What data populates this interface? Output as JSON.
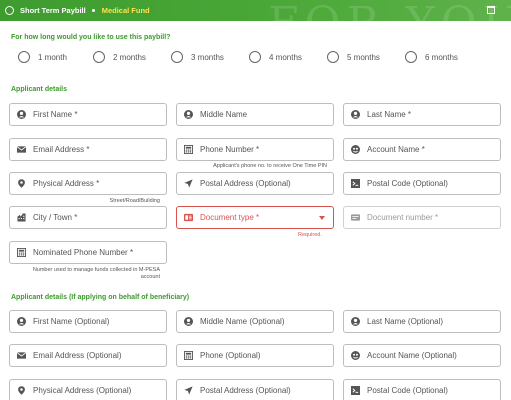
{
  "header": {
    "title": "Short Term Paybill",
    "subtitle": "Medical Fund",
    "background_text": "FOR YOU",
    "accent": "#3e9b2f",
    "subtitle_color": "#ffe24d"
  },
  "duration": {
    "question": "For how long would you like to use this paybill?",
    "options": [
      "1 month",
      "2 months",
      "3 months",
      "4 months",
      "5 months",
      "6 months"
    ]
  },
  "applicant": {
    "section_title": "Applicant details",
    "first_name": "First Name *",
    "middle_name": "Middle Name",
    "last_name": "Last Name *",
    "email": "Email Address *",
    "phone": "Phone Number *",
    "phone_hint": "Applicant's phone no. to receive One Time PIN",
    "account_name": "Account Name *",
    "physical_address": "Physical Address *",
    "physical_hint": "Street/Road/Building",
    "postal_address": "Postal Address (Optional)",
    "postal_code": "Postal Code (Optional)",
    "city": "City / Town *",
    "document_type": "Document type *",
    "document_error": "Required.",
    "document_number": "Document number *",
    "nominated_phone": "Nominated Phone Number *",
    "nominated_hint": "Number used to manage funds collected in M-PESA account"
  },
  "beneficiary": {
    "section_title": "Applicant details (If applying on behalf of beneficiary)",
    "first_name": "First Name (Optional)",
    "middle_name": "Middle Name (Optional)",
    "last_name": "Last Name (Optional)",
    "email": "Email Address (Optional)",
    "phone": "Phone (Optional)",
    "account_name": "Account Name (Optional)",
    "physical_address": "Physical Address (Optional)",
    "postal_address": "Postal Address (Optional)",
    "postal_code": "Postal Code (Optional)"
  },
  "colors": {
    "error": "#d9534f",
    "green": "#3b9a2c"
  }
}
